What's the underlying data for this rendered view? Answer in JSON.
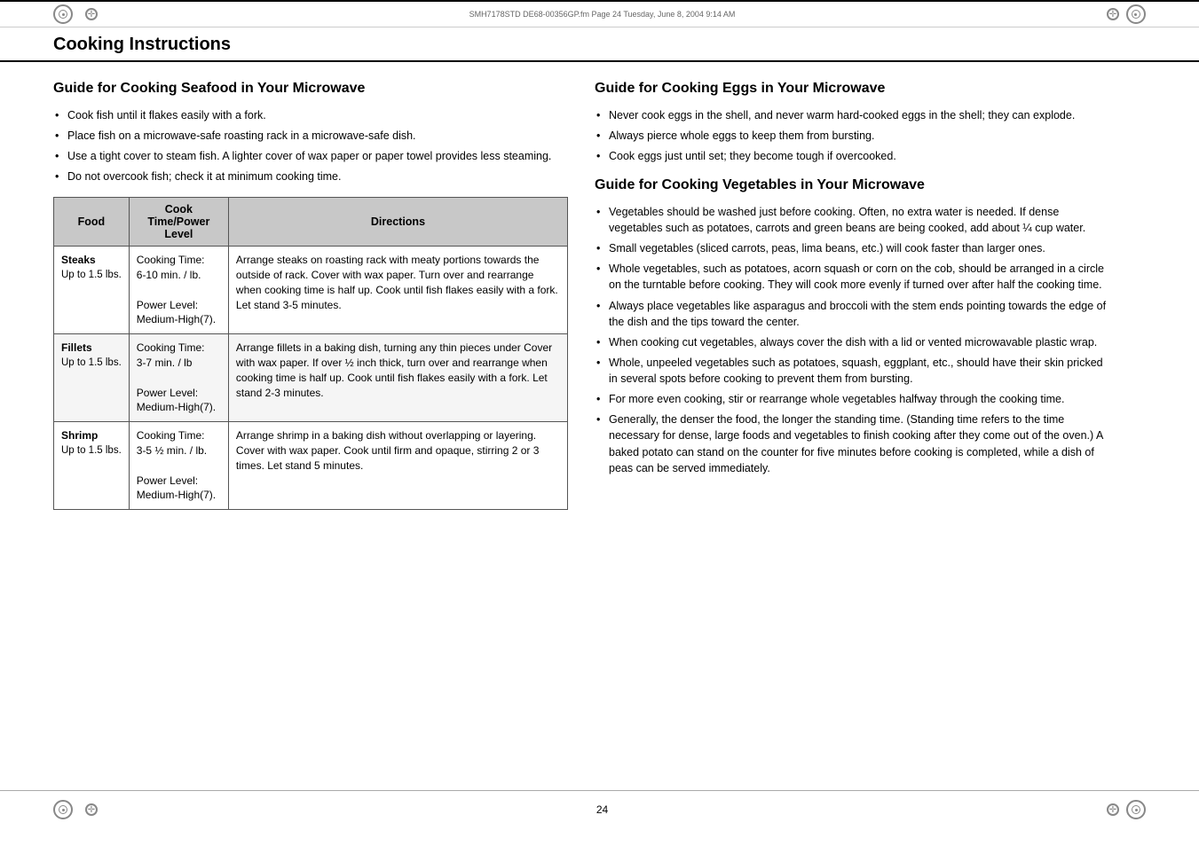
{
  "header": {
    "file_info": "SMH7178STD DE68-00356GP.fm  Page 24  Tuesday, June 8, 2004  9:14 AM"
  },
  "page_title": "Cooking Instructions",
  "left_section": {
    "heading": "Guide for Cooking Seafood in Your Microwave",
    "bullets": [
      "Cook fish until it flakes easily with a fork.",
      "Place fish on a microwave-safe roasting rack in a microwave-safe dish.",
      "Use a tight cover to steam fish. A lighter cover of wax paper or paper towel provides less steaming.",
      "Do not overcook fish; check it at minimum cooking time."
    ],
    "table": {
      "headers": [
        "Food",
        "Cook Time/Power Level",
        "Directions"
      ],
      "rows": [
        {
          "food": "Steaks",
          "food_sub": "Up to 1.5 lbs.",
          "cook_time": "Cooking Time:\n6-10 min. / lb.\n\nPower Level: Medium-High(7).",
          "directions": "Arrange steaks on roasting rack with meaty portions towards the outside of rack. Cover with wax paper. Turn over and rearrange when cooking time is half up. Cook until fish flakes easily with a fork. Let stand 3-5 minutes."
        },
        {
          "food": "Fillets",
          "food_sub": "Up to 1.5 lbs.",
          "cook_time": "Cooking Time:\n3-7 min. / lb\n\nPower Level: Medium-High(7).",
          "directions": "Arrange fillets in a baking dish, turning any thin pieces under Cover with wax paper. If over ½ inch thick, turn over and rearrange when cooking time is half up. Cook until fish flakes easily with a fork. Let stand 2-3 minutes."
        },
        {
          "food": "Shrimp",
          "food_sub": "Up to 1.5 lbs.",
          "cook_time": "Cooking Time:\n3-5 ½ min. / lb.\n\nPower Level: Medium-High(7).",
          "directions": "Arrange shrimp in a baking dish without overlapping or layering. Cover with wax paper. Cook until firm and opaque, stirring 2 or 3 times. Let stand 5 minutes."
        }
      ]
    }
  },
  "right_section": {
    "eggs_heading": "Guide for Cooking Eggs in Your Microwave",
    "eggs_bullets": [
      "Never cook eggs in the shell, and never warm hard-cooked eggs in the shell; they can explode.",
      "Always pierce whole eggs to keep them from bursting.",
      "Cook eggs just until set; they become tough if overcooked."
    ],
    "vegetables_heading": "Guide for Cooking Vegetables in Your Microwave",
    "vegetables_bullets": [
      "Vegetables should be washed just before cooking. Often, no extra water is needed. If dense vegetables such as potatoes, carrots and green beans are being cooked, add about ¼ cup water.",
      "Small vegetables (sliced carrots, peas, lima beans, etc.) will cook faster than larger ones.",
      "Whole vegetables, such as potatoes, acorn squash or corn on the cob, should be arranged in a circle on the turntable before cooking. They will cook more evenly if turned over after half the cooking time.",
      "Always place vegetables like asparagus and broccoli with the stem ends pointing towards the edge of the dish and the tips toward the center.",
      "When cooking cut vegetables, always cover the dish with a lid or vented microwavable plastic wrap.",
      "Whole, unpeeled vegetables such as potatoes, squash, eggplant, etc., should have their skin pricked in several spots before cooking to prevent them from bursting.",
      "For more even cooking, stir or rearrange whole vegetables halfway through the cooking time.",
      "Generally, the denser the food, the longer the standing time. (Standing time refers to the time necessary for dense, large foods and vegetables to finish cooking after they come out of the oven.) A baked potato can stand on the counter for five minutes before cooking is completed, while a dish of peas can be served immediately."
    ]
  },
  "page_number": "24"
}
